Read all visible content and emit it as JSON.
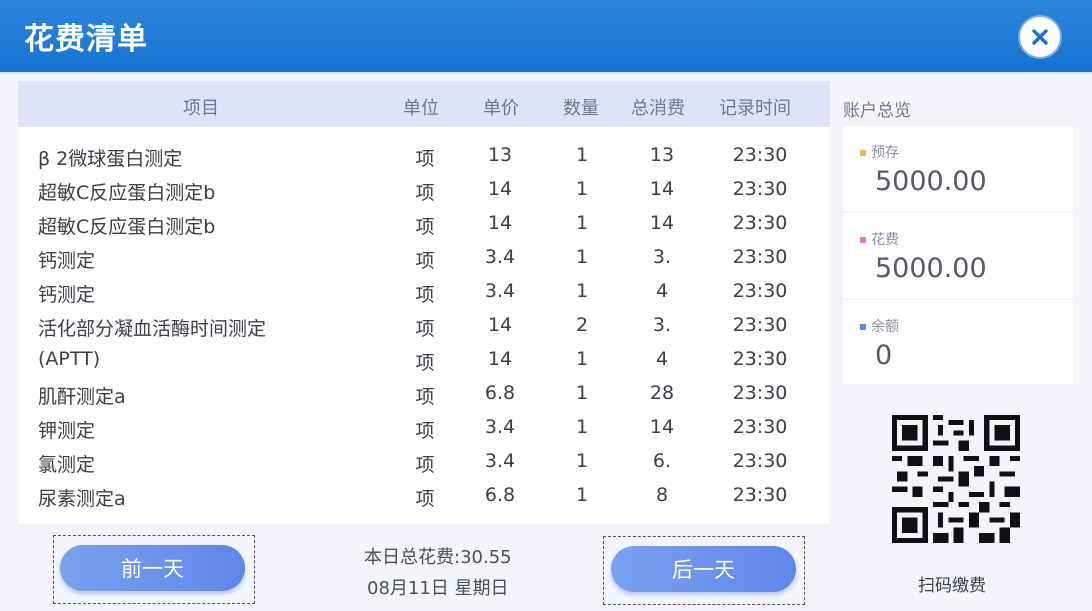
{
  "header": {
    "title": "花费清单"
  },
  "table": {
    "headers": [
      "项目",
      "单位",
      "单价",
      "数量",
      "总消费",
      "记录时间"
    ],
    "rows": [
      [
        "β 2微球蛋白测定",
        "项",
        "13",
        "1",
        "13",
        "23:30"
      ],
      [
        "超敏C反应蛋白测定b",
        "项",
        "14",
        "1",
        "14",
        "23:30"
      ],
      [
        "超敏C反应蛋白测定b",
        "项",
        "14",
        "1",
        "14",
        "23:30"
      ],
      [
        "钙测定",
        "项",
        "3.4",
        "1",
        "3.",
        "23:30"
      ],
      [
        "钙测定",
        "项",
        "3.4",
        "1",
        "4",
        "23:30"
      ],
      [
        "活化部分凝血活酶时间测定",
        "项",
        "14",
        "2",
        "3.",
        "23:30"
      ],
      [
        "(APTT)",
        "项",
        "14",
        "1",
        "4",
        "23:30"
      ],
      [
        "肌酐测定a",
        "项",
        "6.8",
        "1",
        "28",
        "23:30"
      ],
      [
        "钾测定",
        "项",
        "3.4",
        "1",
        "14",
        "23:30"
      ],
      [
        "氯测定",
        "项",
        "3.4",
        "1",
        "6.",
        "23:30"
      ],
      [
        "尿素测定a",
        "项",
        "6.8",
        "1",
        "8",
        "23:30"
      ]
    ]
  },
  "account": {
    "label": "账户总览",
    "items": [
      {
        "label": "预存",
        "value": "5000.00",
        "color": "#f0b64a"
      },
      {
        "label": "花费",
        "value": "5000.00",
        "color": "#d77ad9"
      },
      {
        "label": "余额",
        "value": "0",
        "color": "#5b8be8"
      }
    ]
  },
  "qr_label": "扫码缴费",
  "footer": {
    "prev_label": "前一天",
    "next_label": "后一天",
    "total_text": "本日总花费:30.55",
    "date_text": "08月11日 星期日"
  }
}
